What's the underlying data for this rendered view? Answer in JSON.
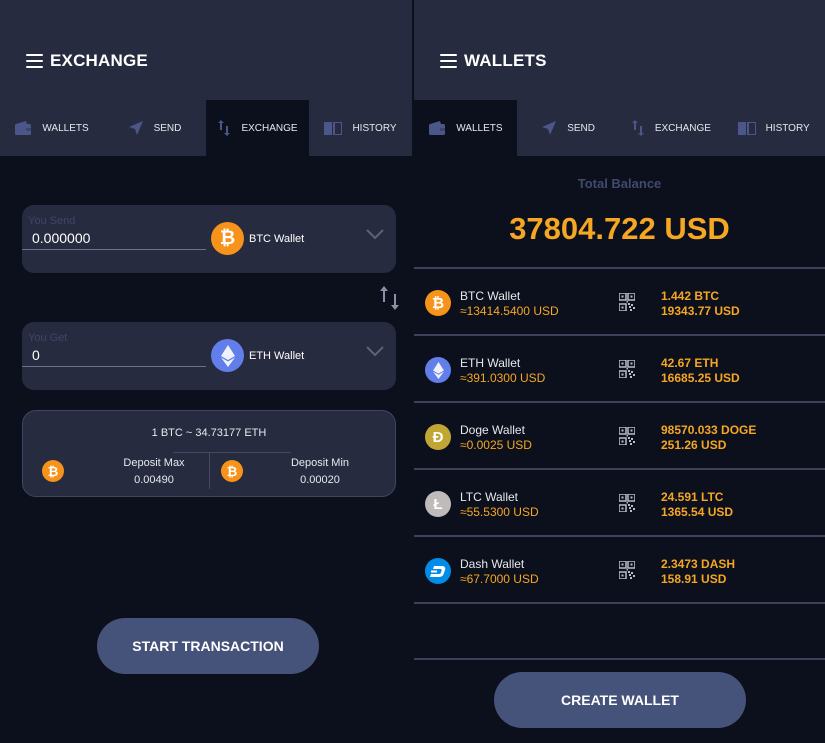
{
  "colors": {
    "accent": "#f5a623",
    "header_bg": "#272b3f",
    "page_bg": "#0c101c",
    "button_bg": "#45527a",
    "btc": "#f7931a",
    "eth": "#627eea",
    "doge": "#c2a633",
    "ltc": "#bfbbbb",
    "dash": "#008ce7"
  },
  "tabs": [
    {
      "label": "WALLETS",
      "icon": "wallet-icon"
    },
    {
      "label": "SEND",
      "icon": "send-icon"
    },
    {
      "label": "EXCHANGE",
      "icon": "swap-arrows-icon"
    },
    {
      "label": "HISTORY",
      "icon": "book-icon"
    }
  ],
  "exchange": {
    "title": "EXCHANGE",
    "active_tab": "EXCHANGE",
    "send": {
      "label": "You Send",
      "value": "0.000000",
      "wallet": "BTC Wallet",
      "coin_icon": "bitcoin-icon"
    },
    "get": {
      "label": "You Get",
      "value": "0",
      "wallet": "ETH Wallet",
      "coin_icon": "ethereum-icon"
    },
    "rate": "1 BTC ~ 34.73177 ETH",
    "deposit_max": {
      "label": "Deposit Max",
      "value": "0.00490"
    },
    "deposit_min": {
      "label": "Deposit Min",
      "value": "0.00020"
    },
    "start_button": "START TRANSACTION"
  },
  "wallets": {
    "title": "WALLETS",
    "active_tab": "WALLETS",
    "total_label": "Total Balance",
    "total_value": "37804.722 USD",
    "items": [
      {
        "name": "BTC Wallet",
        "rate": "≈13414.5400 USD",
        "balance": "1.442 BTC",
        "balance_usd": "19343.77 USD",
        "symbol": "₿",
        "coin": "btc"
      },
      {
        "name": "ETH Wallet",
        "rate": "≈391.0300 USD",
        "balance": "42.67 ETH",
        "balance_usd": "16685.25 USD",
        "symbol": "Ξ",
        "coin": "eth"
      },
      {
        "name": "Doge Wallet",
        "rate": "≈0.0025 USD",
        "balance": "98570.033 DOGE",
        "balance_usd": "251.26 USD",
        "symbol": "Ð",
        "coin": "doge"
      },
      {
        "name": "LTC Wallet",
        "rate": "≈55.5300 USD",
        "balance": "24.591 LTC",
        "balance_usd": "1365.54 USD",
        "symbol": "Ł",
        "coin": "ltc"
      },
      {
        "name": "Dash Wallet",
        "rate": "≈67.7000 USD",
        "balance": "2.3473 DASH",
        "balance_usd": "158.91 USD",
        "symbol": "D",
        "coin": "dash"
      }
    ],
    "create_button": "CREATE WALLET"
  }
}
